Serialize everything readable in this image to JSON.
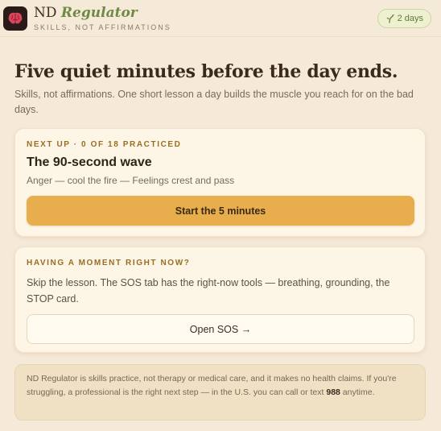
{
  "header": {
    "brand_prefix": "ND",
    "brand_italic": "Regulator",
    "tagline": "SKILLS, NOT AFFIRMATIONS",
    "streak_label": "2 days",
    "streak_icon": "sprout-icon",
    "logo_icon": "brain-icon"
  },
  "hero": {
    "title": "Five quiet minutes before the day ends.",
    "subtitle": "Skills, not affirmations. One short lesson a day builds the muscle you reach for on the bad days."
  },
  "next_up": {
    "eyebrow": "NEXT UP · 0 OF 18 PRACTICED",
    "practiced": 0,
    "total": 18,
    "lesson_title": "The 90-second wave",
    "lesson_meta": "Anger — cool the fire — Feelings crest and pass",
    "button_label": "Start the 5 minutes"
  },
  "moment": {
    "eyebrow": "HAVING A MOMENT RIGHT NOW?",
    "body": "Skip the lesson. The SOS tab has the right-now tools — breathing, grounding, the STOP card.",
    "button_label": "Open SOS →"
  },
  "disclaimer": {
    "text_before": "ND Regulator is skills practice, not therapy or medical care, and it makes no health claims. If you're struggling, a professional is the right next step — in the U.S. you can call or text ",
    "hotline": "988",
    "text_after": " anytime."
  },
  "colors": {
    "background": "#f5ead8",
    "accent": "#e8ad4c",
    "brand_green": "#6f8a46",
    "eyebrow": "#9a6e22"
  }
}
